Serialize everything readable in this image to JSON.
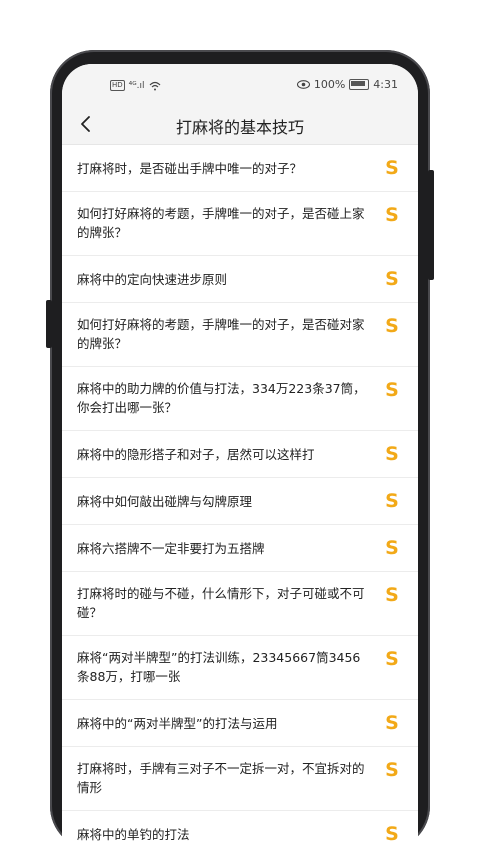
{
  "status_bar": {
    "hd": "HD",
    "signal": "⁴ᴳ.ıl",
    "battery_percent": "100%",
    "time": "4:31"
  },
  "nav": {
    "title": "打麻将的基本技巧"
  },
  "articles": [
    "打麻将时，是否碰出手牌中唯一的对子？",
    "如何打好麻将的考题，手牌唯一的对子，是否碰上家的牌张？",
    "麻将中的定向快速进步原则",
    "如何打好麻将的考题，手牌唯一的对子，是否碰对家的牌张？",
    "麻将中的助力牌的价值与打法，334万223条37筒，你会打出哪一张？",
    "麻将中的隐形搭子和对子，居然可以这样打",
    "麻将中如何敲出碰牌与勾牌原理",
    "麻将六搭牌不一定非要打为五搭牌",
    "打麻将时的碰与不碰，什么情形下，对子可碰或不可碰？",
    "麻将“两对半牌型”的打法训练，23345667筒3456条88万，打哪一张",
    "麻将中的“两对半牌型”的打法与运用",
    "打麻将时，手牌有三对子不一定拆一对，不宜拆对的情形",
    "麻将中的单钓的打法"
  ],
  "colors": {
    "accent_coin": "#f2a918",
    "nav_bg": "#f4f4f4",
    "phone_frame": "#1e1e20"
  },
  "icons": [
    "back-arrow-icon",
    "eye-icon",
    "wifi-icon",
    "battery-icon",
    "coin-s-icon"
  ]
}
